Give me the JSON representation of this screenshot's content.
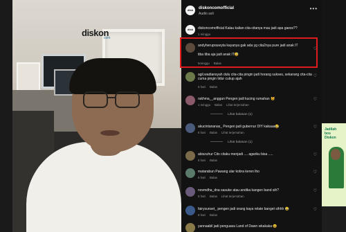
{
  "video": {
    "logo_text": "diskon",
    "logo_sub": "com"
  },
  "header": {
    "account": "diskoncomofficial",
    "subtitle": "Audio asli",
    "more_icon": "more-icon"
  },
  "comments": [
    {
      "text": "diskoncomofficial Kalau kalian cita-citanya mau jadi apa gaess??",
      "meta": [
        "1 minggu"
      ],
      "avatar": "brand"
    },
    {
      "text": "andyherupraseyta kayanya gak ada yg cita2nya pure jadi anak IT",
      "text2": "tiba tiba aja jadi anak IT😅",
      "meta": [
        "5minggu",
        "Balas"
      ],
      "highlighted": true
    },
    {
      "text": "agil.wadiansyah dulu cita-cita pingin jadi horang sukses, sekarang cita-cita cuma pingin tidur cukup ajah",
      "meta": [
        "6 hari",
        "Balas"
      ]
    },
    {
      "text": "rakhma__anggun Pengen jadi kucing rumahan 😺",
      "meta": [
        "1 minggu",
        "Balas",
        "Lihat terjemahan"
      ],
      "replies": "Lihat balasan (1)"
    },
    {
      "text": "akucintananas_ Pengen jadi gubernur DIY kakaaa😂",
      "meta": [
        "6 hari",
        "Balas",
        "Lihat terjemahan"
      ],
      "replies": "Lihat balasan (1)"
    },
    {
      "text": "abiszuhur Cits citaku menjadi .... agariku bisa .....",
      "meta": [
        "6 hari",
        "Balas"
      ]
    },
    {
      "text": "matarabun Pawang ular kobra keren lho",
      "meta": [
        "5 hari",
        "Balas"
      ]
    },
    {
      "text": "novmdha_dna sasuke atau andika kangen band sih?",
      "meta": [
        "5 hari",
        "Balas",
        "Lihat terjemahan"
      ]
    },
    {
      "text": "fairysunset_ pengen jadi orang kaya relate banget sihhh 😂",
      "meta": [
        "6 hari",
        "Balas"
      ]
    },
    {
      "text": "yannaabil jadi penguasa Land of Dawn wkakaka 😆",
      "meta": []
    }
  ],
  "right_strip": {
    "text": "Jadilah\nbos\nDiskon"
  },
  "colors": {
    "panel_bg": "#121212",
    "highlight_border": "#e01c1c",
    "brand_blue": "#2e9ad6"
  }
}
